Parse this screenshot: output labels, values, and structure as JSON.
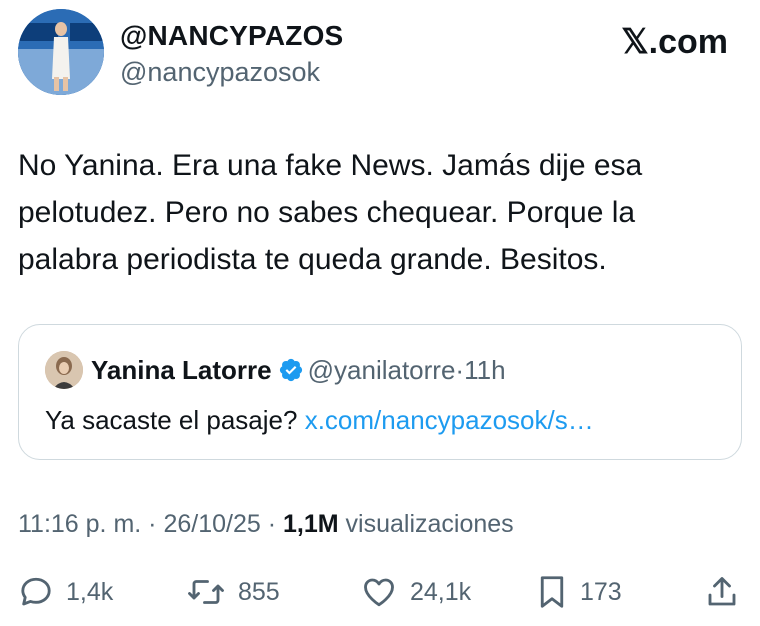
{
  "header": {
    "display_name": "@NANCYPAZOS",
    "username": "@nancypazosok",
    "brand": "𝕏.com",
    "avatar_icon": "profile-avatar"
  },
  "tweet": {
    "text": "No Yanina. Era una fake News. Jamás dije esa pelotudez. Pero no sabes chequear. Porque la palabra periodista te queda grande. Besitos."
  },
  "quote": {
    "name": "Yanina Latorre",
    "username": "@yanilatorre",
    "separator": "·",
    "time": "11h",
    "text": "Ya sacaste el pasaje?",
    "link": "x.com/nancypazosok/s…",
    "verified_color": "#1d9bf0"
  },
  "meta": {
    "time": "11:16 p. m.",
    "sep1": " · ",
    "date": "26/10/25",
    "sep2": " · ",
    "views_count": "1,1M",
    "views_label": " visualizaciones"
  },
  "actions": {
    "replies": "1,4k",
    "reposts": "855",
    "likes": "24,1k",
    "bookmarks": "173"
  },
  "colors": {
    "text": "#0f1419",
    "muted": "#536471",
    "link": "#1d9bf0",
    "border": "#cfd9de"
  }
}
